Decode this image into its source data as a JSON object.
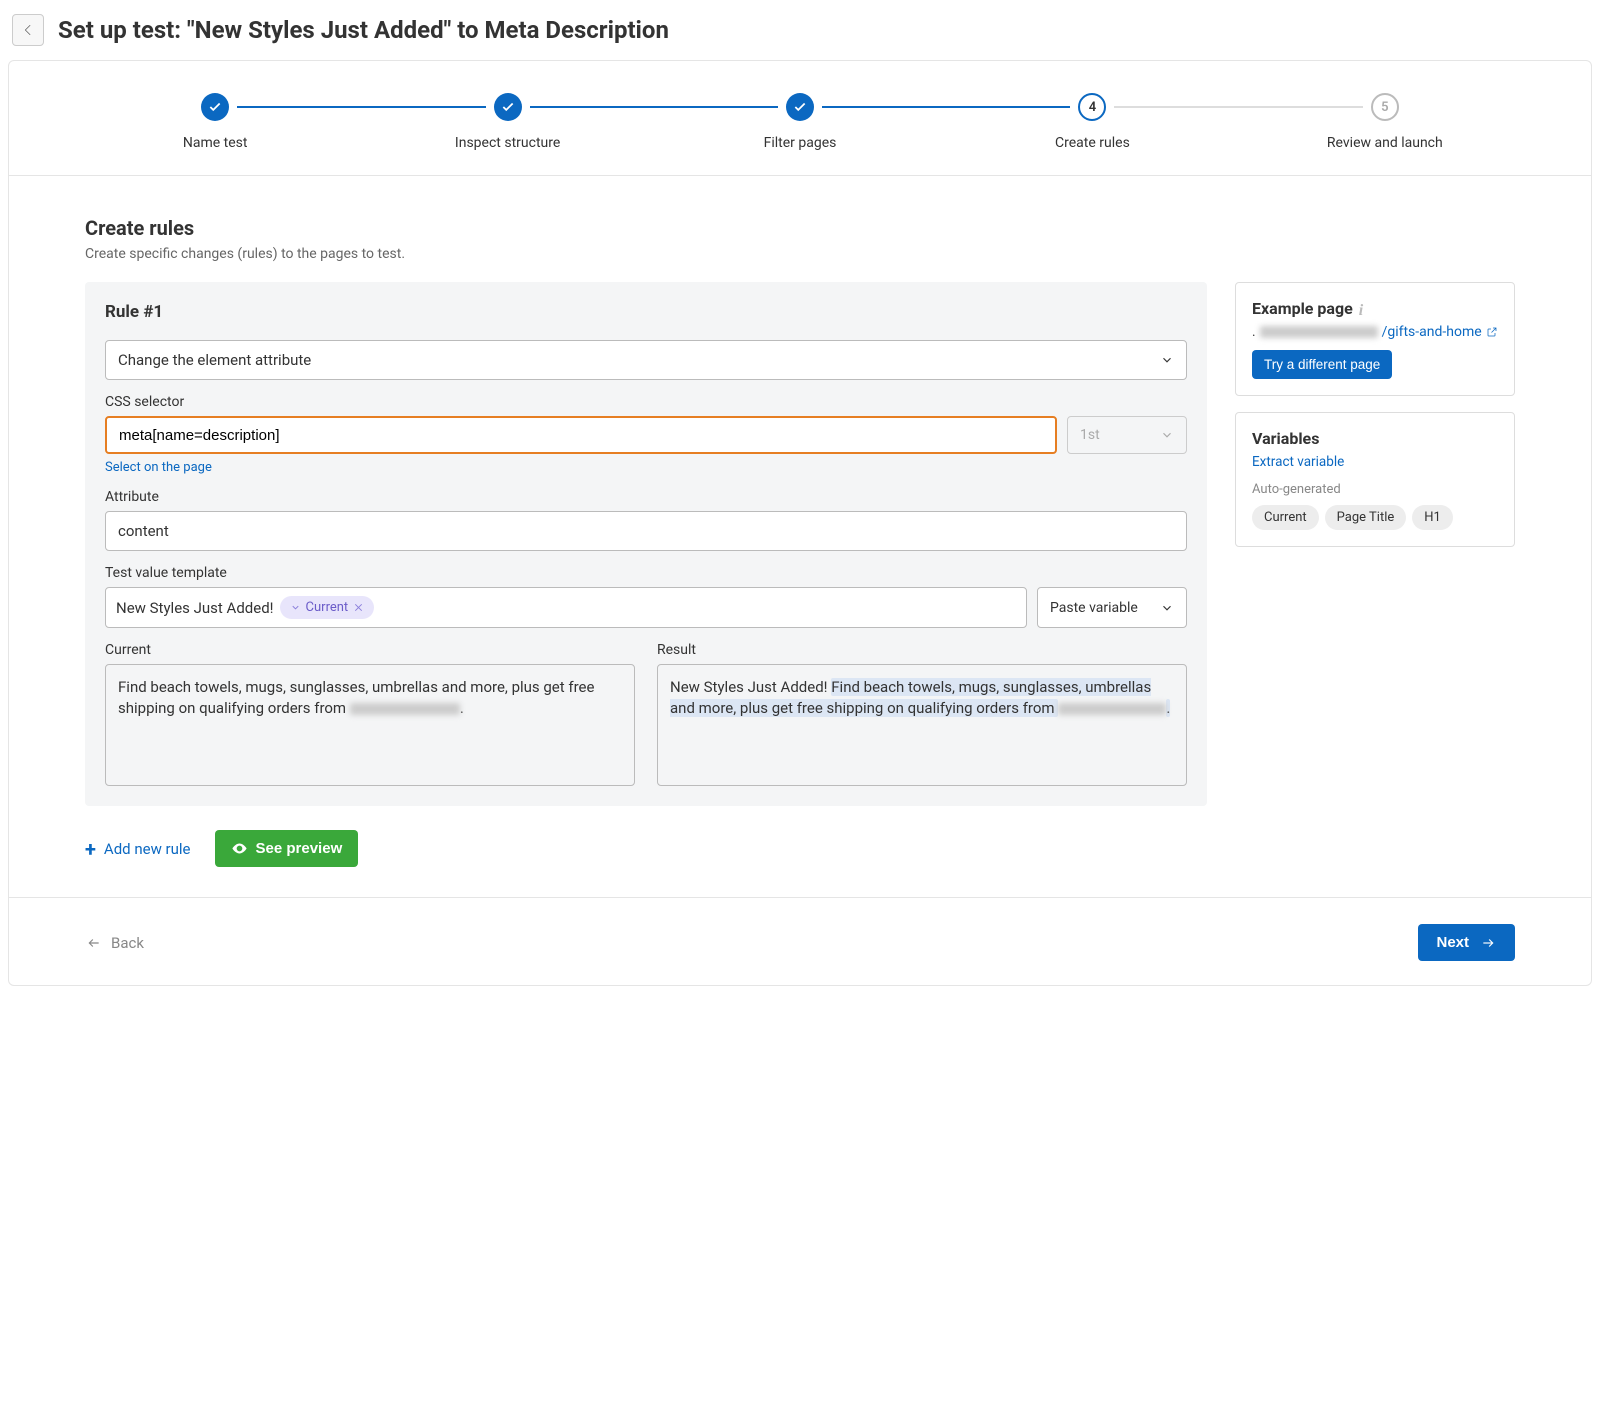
{
  "header": {
    "title": "Set up test: \"New Styles Just Added\" to Meta Description"
  },
  "stepper": {
    "steps": [
      {
        "label": "Name test",
        "state": "done"
      },
      {
        "label": "Inspect structure",
        "state": "done"
      },
      {
        "label": "Filter pages",
        "state": "done"
      },
      {
        "label": "Create rules",
        "state": "current",
        "num": "4"
      },
      {
        "label": "Review and launch",
        "state": "future",
        "num": "5"
      }
    ]
  },
  "section": {
    "title": "Create rules",
    "subtitle": "Create specific changes (rules) to the pages to test."
  },
  "rule": {
    "title": "Rule #1",
    "action": "Change the element attribute",
    "css_label": "CSS selector",
    "css_value": "meta[name=description]",
    "ordinal": "1st",
    "select_link": "Select on the page",
    "attr_label": "Attribute",
    "attr_value": "content",
    "template_label": "Test value template",
    "template_text": "New Styles Just Added!",
    "template_chip": "Current",
    "paste_label": "Paste variable",
    "current_label": "Current",
    "result_label": "Result",
    "current_text_a": "Find beach towels, mugs, sunglasses, umbrellas and more, plus get free shipping on qualifying orders from ",
    "current_text_b": ".",
    "result_prefix": "New Styles Just Added! ",
    "result_hl_a": "Find beach towels, mugs, sunglasses, umbrellas and more, plus get free shipping on qualifying orders from ",
    "result_dot": "."
  },
  "actions": {
    "add_rule": "Add new rule",
    "preview": "See preview"
  },
  "example": {
    "title": "Example page",
    "suffix": "/gifts-and-home",
    "try_button": "Try a different page"
  },
  "variables": {
    "title": "Variables",
    "extract": "Extract variable",
    "auto_label": "Auto-generated",
    "chips": [
      "Current",
      "Page Title",
      "H1"
    ]
  },
  "footer": {
    "back": "Back",
    "next": "Next"
  }
}
